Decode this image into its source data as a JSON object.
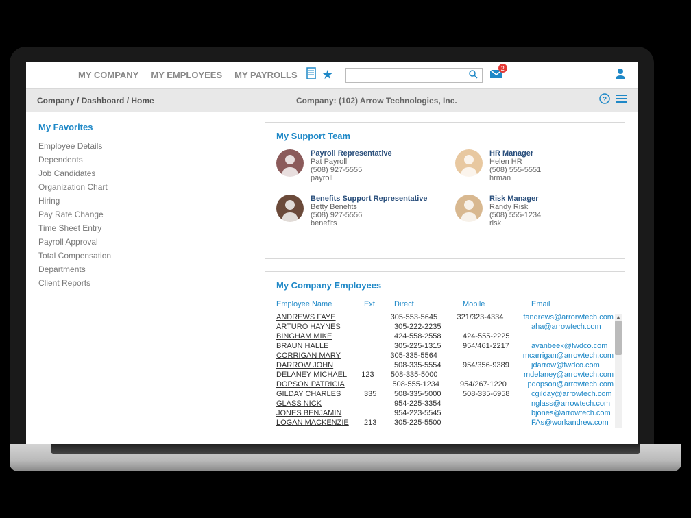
{
  "nav": {
    "items": [
      "MY COMPANY",
      "MY EMPLOYEES",
      "MY PAYROLLS"
    ],
    "mail_badge": "2"
  },
  "search": {
    "placeholder": ""
  },
  "breadcrumb": "Company / Dashboard / Home",
  "company_label": "Company: (102) Arrow Technologies, Inc.",
  "sidebar": {
    "title": "My Favorites",
    "items": [
      "Employee Details",
      "Dependents",
      "Job Candidates",
      "Organization Chart",
      "Hiring",
      "Pay Rate Change",
      "Time Sheet Entry",
      "Payroll Approval",
      "Total Compensation",
      "Departments",
      "Client Reports"
    ]
  },
  "support": {
    "title": "My Support Team",
    "contacts": [
      {
        "role": "Payroll Representative",
        "name": "Pat Payroll",
        "phone": "(508) 927-5555",
        "tag": "payroll"
      },
      {
        "role": "HR Manager",
        "name": "Helen HR",
        "phone": "(508) 555-5551",
        "tag": "hrman"
      },
      {
        "role": "Benefits Support Representative",
        "name": "Betty Benefits",
        "phone": "(508) 927-5556",
        "tag": "benefits"
      },
      {
        "role": "Risk Manager",
        "name": "Randy Risk",
        "phone": "(508) 555-1234",
        "tag": "risk"
      }
    ]
  },
  "employees": {
    "title": "My Company Employees",
    "columns": {
      "name": "Employee Name",
      "ext": "Ext",
      "direct": "Direct",
      "mobile": "Mobile",
      "email": "Email"
    },
    "rows": [
      {
        "name": "ANDREWS FAYE",
        "ext": "",
        "direct": "305-553-5645",
        "mobile": "321/323-4334",
        "email": "fandrews@arrorwtech.com"
      },
      {
        "name": "ARTURO HAYNES",
        "ext": "",
        "direct": "305-222-2235",
        "mobile": "",
        "email": "aha@arrowtech.com"
      },
      {
        "name": "BINGHAM MIKE",
        "ext": "",
        "direct": "424-558-2558",
        "mobile": "424-555-2225",
        "email": ""
      },
      {
        "name": "BRAUN HALLE",
        "ext": "",
        "direct": "305-225-1315",
        "mobile": "954/461-2217",
        "email": "avanbeek@fwdco.com"
      },
      {
        "name": "CORRIGAN MARY",
        "ext": "",
        "direct": "305-335-5564",
        "mobile": "",
        "email": "mcarrigan@arrowtech.com"
      },
      {
        "name": "DARROW JOHN",
        "ext": "",
        "direct": "508-335-5554",
        "mobile": "954/356-9389",
        "email": "jdarrow@fwdco.com"
      },
      {
        "name": "DELANEY MICHAEL",
        "ext": "123",
        "direct": "508-335-5000",
        "mobile": "",
        "email": "mdelaney@arrowtech.com"
      },
      {
        "name": "DOPSON PATRICIA",
        "ext": "",
        "direct": "508-555-1234",
        "mobile": "954/267-1220",
        "email": "pdopson@arrowtech.com"
      },
      {
        "name": "GILDAY CHARLES",
        "ext": "335",
        "direct": "508-335-5000",
        "mobile": "508-335-6958",
        "email": "cgilday@arrowtech.com"
      },
      {
        "name": "GLASS NICK",
        "ext": "",
        "direct": "954-225-3354",
        "mobile": "",
        "email": "nglass@arrowtech.com"
      },
      {
        "name": "JONES BENJAMIN",
        "ext": "",
        "direct": "954-223-5545",
        "mobile": "",
        "email": "bjones@arrowtech.com"
      },
      {
        "name": "LOGAN MACKENZIE",
        "ext": "213",
        "direct": "305-225-5500",
        "mobile": "",
        "email": "FAs@workandrew.com"
      }
    ]
  }
}
